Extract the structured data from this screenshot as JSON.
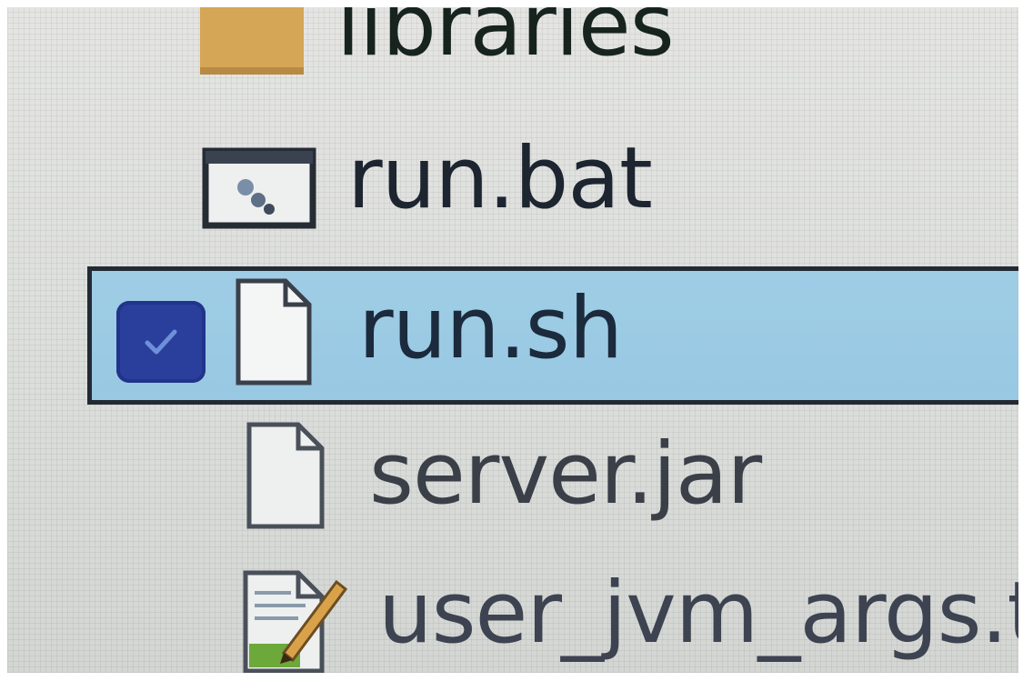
{
  "file_list": {
    "items": [
      {
        "name": "libraries",
        "icon": "folder-icon",
        "selected": false,
        "checked": false
      },
      {
        "name": "run.bat",
        "icon": "batch-file-icon",
        "selected": false,
        "checked": false
      },
      {
        "name": "run.sh",
        "icon": "blank-file-icon",
        "selected": true,
        "checked": true
      },
      {
        "name": "server.jar",
        "icon": "blank-file-icon",
        "selected": false,
        "checked": false
      },
      {
        "name": "user_jvm_args.txt",
        "icon": "text-document-icon",
        "selected": false,
        "checked": false
      }
    ]
  },
  "colors": {
    "background": "#dcdedb",
    "selection": "#9fcde6",
    "selection_border": "#232a33",
    "checkbox": "#2a3f9c",
    "folder": "#d4a656",
    "text": "#1d2530"
  }
}
